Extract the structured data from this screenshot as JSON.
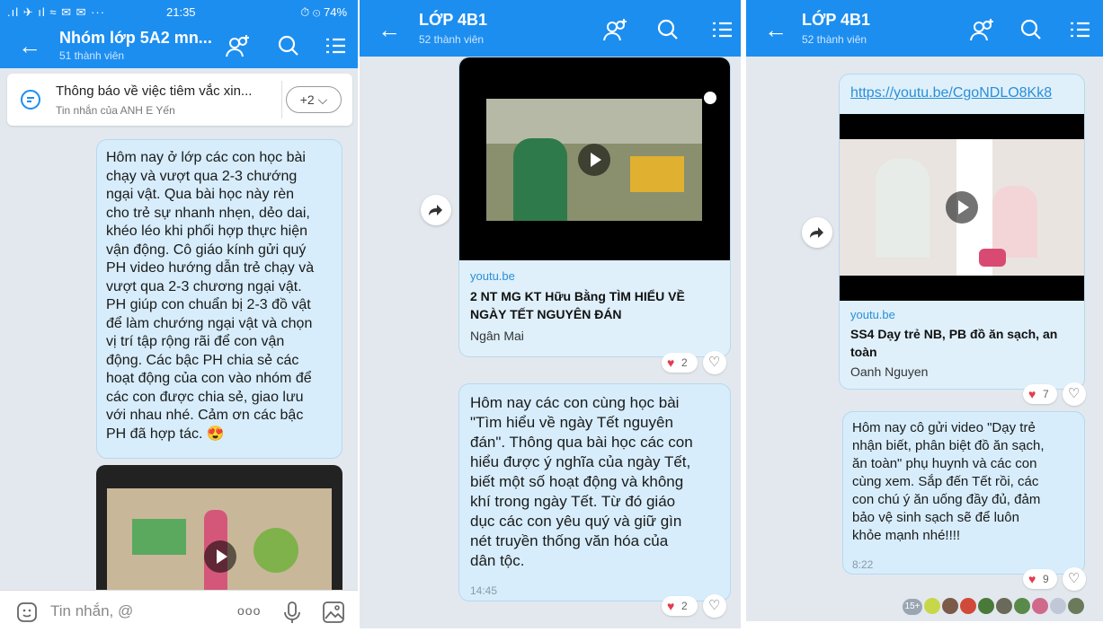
{
  "screen1": {
    "status": {
      "left": ".ıl ✈ ıl ≈ ✉ ✉ ···",
      "time": "21:35",
      "right": "⏱ ⊙ 74%"
    },
    "header": {
      "title": "Nhóm lớp 5A2 mn...",
      "subtitle": "51 thành viên"
    },
    "pinned": {
      "text": "Thông báo về việc tiêm vắc xin...",
      "from": "Tin nhắn của ANH E Yến",
      "more": "+2"
    },
    "message": {
      "text": "Hôm nay ở lớp các con học bài\nchạy và vượt qua 2-3 chướng\nngại vật. Qua bài học này rèn\ncho  trẻ sự nhanh nhẹn, dẻo dai,\nkhéo léo khi phối hợp thực hiện\nvận động. Cô giáo kính gửi quý\nPH video hướng dẫn trẻ chạy và\nvượt qua 2-3 chương ngại vật.\nPH giúp con chuẩn bị 2-3 đồ vật\nđể làm chướng ngại vật và chọn\nvị trí tập rộng rãi để con vận\nđộng. Các bậc PH chia sẻ các\nhoạt động của con vào nhóm để\ncác con được chia sẻ, giao lưu\nvới nhau nhé. Cảm ơn các bậc\nPH đã hợp tác. 😍"
    },
    "input": {
      "placeholder": "Tin nhắn, @"
    }
  },
  "screen2": {
    "header": {
      "title": "LỚP 4B1",
      "subtitle": "52 thành viên"
    },
    "link": {
      "domain": "youtu.be",
      "title": "2 NT MG KT Hữu Bằng   TÌM HIỂU VỀ\nNGÀY TẾT NGUYÊN ĐÁN",
      "author": "Ngân Mai",
      "reactions": "2"
    },
    "message": {
      "text": "Hôm nay các con cùng học bài\n\"Tìm hiểu về ngày Tết nguyên\nđán\". Thông qua bài học các con\nhiểu được ý nghĩa của ngày Tết,\nbiết một số hoạt động và không\nkhí trong ngày Tết. Từ đó giáo\ndục các con yêu quý và giữ gìn\nnét truyền thống văn hóa của\ndân tộc.",
      "time": "14:45",
      "reactions": "2"
    }
  },
  "screen3": {
    "header": {
      "title": "LỚP 4B1",
      "subtitle": "52 thành viên"
    },
    "link": {
      "url": "https://youtu.be/CgoNDLO8Kk8",
      "domain": "youtu.be",
      "title": "SS4  Dạy trẻ NB, PB đồ ăn sạch, an\ntoàn",
      "author": "Oanh Nguyen",
      "reactions": "7"
    },
    "message": {
      "text": "Hôm nay cô gửi video \"Dạy trẻ\nnhận biết, phân biệt đồ ăn sạch,\năn toàn\" phụ huynh và các con\ncùng xem. Sắp đến Tết rồi, các\ncon chú ý ăn uống đầy đủ, đảm\nbảo vệ sinh sạch sẽ để luôn\nkhỏe mạnh nhé!!!!",
      "time": "8:22",
      "reactions": "9"
    },
    "seen": {
      "count": "15+"
    }
  },
  "colors": {
    "accent": "#1c8ef0",
    "bubble": "#d7edfb",
    "heart": "#e53b4f"
  }
}
